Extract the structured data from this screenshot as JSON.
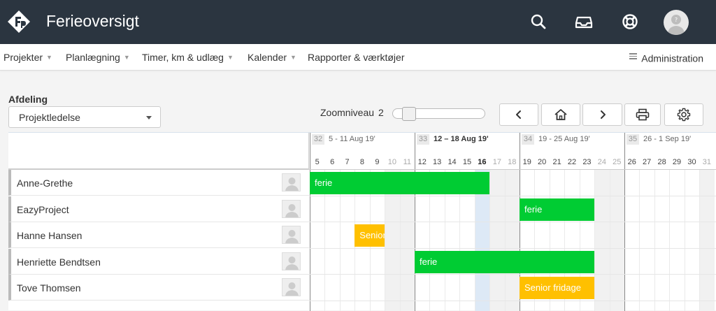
{
  "app": {
    "title": "Ferieoversigt",
    "colors": {
      "topbar": "#2b3540",
      "ferie": "#00cc33",
      "fridage": "#ffc000",
      "today": "#dde9f6"
    }
  },
  "topbar_icons": [
    "search-icon",
    "inbox-icon",
    "help-lifebuoy-icon",
    "user-avatar"
  ],
  "menu": {
    "items": [
      {
        "label": "Projekter",
        "dropdown": true
      },
      {
        "label": "Planlægning",
        "dropdown": true
      },
      {
        "label": "Timer, km & udlæg",
        "dropdown": true
      },
      {
        "label": "Kalender",
        "dropdown": true
      },
      {
        "label": "Rapporter & værktøjer",
        "dropdown": false
      }
    ],
    "admin_label": "Administration"
  },
  "filter": {
    "label": "Afdeling",
    "selected": "Projektledelse"
  },
  "zoom": {
    "label": "Zoomniveau",
    "value": "2"
  },
  "toolbar_icons": [
    "prev-icon",
    "home-icon",
    "next-icon",
    "print-icon",
    "settings-icon"
  ],
  "calendar": {
    "weeks": [
      {
        "number": "32",
        "range": "5 - 11 Aug 19'",
        "current": false
      },
      {
        "number": "33",
        "range": "12 – 18 Aug 19'",
        "current": true
      },
      {
        "number": "34",
        "range": "19 - 25 Aug 19'",
        "current": false
      },
      {
        "number": "35",
        "range": "26 - 1 Sep 19'",
        "current": false
      }
    ],
    "days": [
      "5",
      "6",
      "7",
      "8",
      "9",
      "10",
      "11",
      "12",
      "13",
      "14",
      "15",
      "16",
      "17",
      "18",
      "19",
      "20",
      "21",
      "22",
      "23",
      "24",
      "25",
      "26",
      "27",
      "28",
      "29",
      "30",
      "31"
    ],
    "weekend_days": [
      "10",
      "11",
      "17",
      "18",
      "24",
      "25",
      "31"
    ],
    "today": "16",
    "people": [
      {
        "name": "Anne-Grethe",
        "bars": [
          {
            "label": "ferie",
            "type": "ferie",
            "start_day": "5",
            "end_day": "16"
          }
        ]
      },
      {
        "name": "EazyProject",
        "bars": [
          {
            "label": "ferie",
            "type": "ferie",
            "start_day": "19",
            "end_day": "23"
          }
        ]
      },
      {
        "name": "Hanne Hansen",
        "bars": [
          {
            "label": "Senior fridage",
            "type": "fridage",
            "start_day": "8",
            "end_day": "9"
          }
        ]
      },
      {
        "name": "Henriette Bendtsen",
        "bars": [
          {
            "label": "ferie",
            "type": "ferie",
            "start_day": "12",
            "end_day": "23"
          }
        ]
      },
      {
        "name": "Tove Thomsen",
        "bars": [
          {
            "label": "Senior fridage",
            "type": "fridage",
            "start_day": "19",
            "end_day": "23"
          }
        ]
      }
    ]
  }
}
